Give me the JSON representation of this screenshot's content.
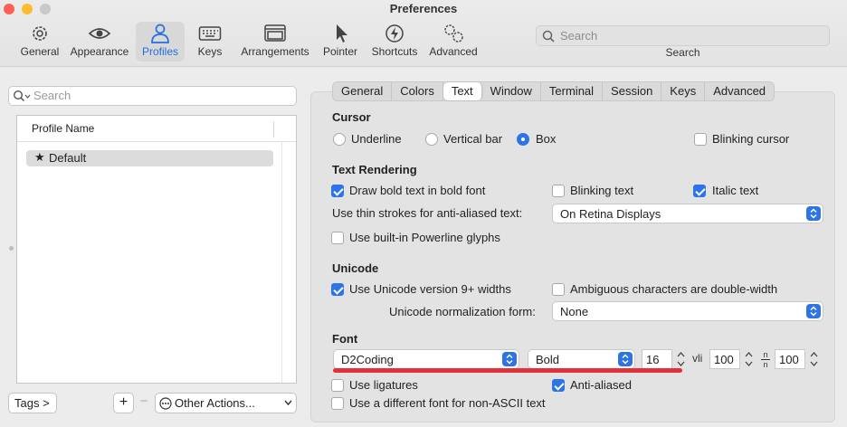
{
  "window": {
    "title": "Preferences",
    "traffic_lights": {
      "close": "#fe5f57",
      "minimize": "#febb2e",
      "zoom": "#c9c9c9"
    }
  },
  "toolbar": {
    "items": [
      {
        "label": "General",
        "icon": "gear-icon"
      },
      {
        "label": "Appearance",
        "icon": "eye-icon"
      },
      {
        "label": "Profiles",
        "icon": "person-icon",
        "selected": true
      },
      {
        "label": "Keys",
        "icon": "keyboard-icon"
      },
      {
        "label": "Arrangements",
        "icon": "window-stack-icon"
      },
      {
        "label": "Pointer",
        "icon": "pointer-icon"
      },
      {
        "label": "Shortcuts",
        "icon": "bolt-icon"
      },
      {
        "label": "Advanced",
        "icon": "gears-icon"
      }
    ],
    "search": {
      "placeholder": "Search",
      "caption": "Search"
    },
    "accent": "#1f6fe5"
  },
  "profiles": {
    "search_placeholder": "Search",
    "column_header": "Profile Name",
    "rows": [
      {
        "name": "Default",
        "icon": "star-icon"
      }
    ],
    "tags_button": "Tags >",
    "add_button": "+",
    "remove_button": "−",
    "other_actions": "Other Actions..."
  },
  "tabs": {
    "items": [
      "General",
      "Colors",
      "Text",
      "Window",
      "Terminal",
      "Session",
      "Keys",
      "Advanced"
    ],
    "active": "Text"
  },
  "cursor": {
    "title": "Cursor",
    "options": [
      "Underline",
      "Vertical bar",
      "Box"
    ],
    "selected": "Box",
    "blinking_label": "Blinking cursor",
    "blinking": false
  },
  "text_rendering": {
    "title": "Text Rendering",
    "bold_label": "Draw bold text in bold font",
    "bold": true,
    "blinking_text_label": "Blinking text",
    "blinking_text": false,
    "italic_label": "Italic text",
    "italic": true,
    "thin_strokes_label": "Use thin strokes for anti-aliased text:",
    "thin_strokes_value": "On Retina Displays",
    "powerline_label": "Use built-in Powerline glyphs",
    "powerline": false
  },
  "unicode": {
    "title": "Unicode",
    "widths_label": "Use Unicode version 9+ widths",
    "widths": true,
    "ambiguous_label": "Ambiguous characters are double-width",
    "ambiguous": false,
    "normalization_label": "Unicode normalization form:",
    "normalization_value": "None"
  },
  "font": {
    "title": "Font",
    "family": "D2Coding",
    "weight": "Bold",
    "size": "16",
    "h_spacing_icon": "vli",
    "h_spacing": "100",
    "v_spacing_icon": "n/n",
    "v_spacing": "100",
    "ligatures_label": "Use ligatures",
    "ligatures": false,
    "antialiased_label": "Anti-aliased",
    "antialiased": true,
    "non_ascii_label": "Use a different font for non-ASCII text",
    "non_ascii": false,
    "highlight_color": "#e0333c"
  }
}
